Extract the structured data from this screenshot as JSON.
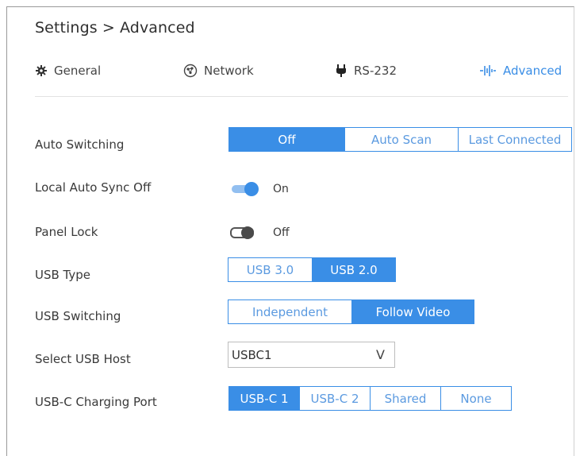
{
  "breadcrumb": "Settings > Advanced",
  "tabs": [
    {
      "label": "General",
      "icon": "gear-icon"
    },
    {
      "label": "Network",
      "icon": "network-icon"
    },
    {
      "label": "RS-232",
      "icon": "plug-icon"
    },
    {
      "label": "Advanced",
      "icon": "waveform-icon"
    }
  ],
  "active_tab": "Advanced",
  "accent_color": "#3a8ee6",
  "settings": {
    "auto_switching": {
      "label": "Auto Switching",
      "options": [
        "Off",
        "Auto Scan",
        "Last Connected"
      ],
      "selected": "Off"
    },
    "local_auto_sync_off": {
      "label": "Local Auto Sync Off",
      "state": "On"
    },
    "panel_lock": {
      "label": "Panel Lock",
      "state": "Off"
    },
    "usb_type": {
      "label": "USB Type",
      "options": [
        "USB 3.0",
        "USB 2.0"
      ],
      "selected": "USB 2.0"
    },
    "usb_switching": {
      "label": "USB Switching",
      "options": [
        "Independent",
        "Follow Video"
      ],
      "selected": "Follow Video"
    },
    "select_usb_host": {
      "label": "Select USB Host",
      "value": "USBC1",
      "chevron": "V"
    },
    "usb_c_charging_port": {
      "label": "USB-C Charging Port",
      "options": [
        "USB-C 1",
        "USB-C 2",
        "Shared",
        "None"
      ],
      "selected": "USB-C 1"
    }
  }
}
